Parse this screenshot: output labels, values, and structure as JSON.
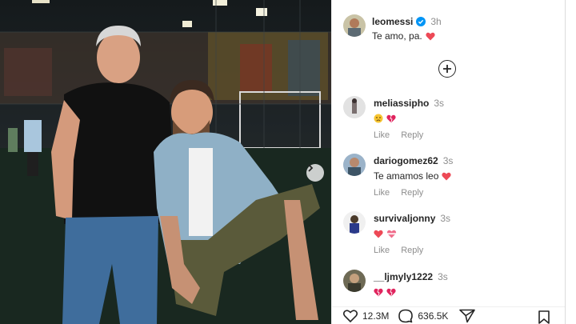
{
  "post": {
    "author": "leomessi",
    "time": "3h",
    "caption": "Te amo, pa.",
    "verified_color": "#0095f6",
    "heart_color": "#ed4956"
  },
  "comments": [
    {
      "username": "meliassipho",
      "time": "3s",
      "text": "",
      "emojis": [
        "sad-face-icon",
        "broken-heart-icon"
      ]
    },
    {
      "username": "dariogomez62",
      "time": "3s",
      "text": "Te amamos leo",
      "emojis": [
        "heart-icon"
      ]
    },
    {
      "username": "survivaljonny",
      "time": "3s",
      "text": "",
      "emojis": [
        "heart-icon",
        "heart-ribbon-icon"
      ]
    },
    {
      "username": "__ljmyly1222",
      "time": "3s",
      "text": "",
      "emojis": [
        "broken-heart-icon",
        "broken-heart-icon"
      ]
    }
  ],
  "actions": {
    "like": "Like",
    "reply": "Reply"
  },
  "stats": {
    "likes": "12.3M",
    "comments": "636.5K"
  }
}
